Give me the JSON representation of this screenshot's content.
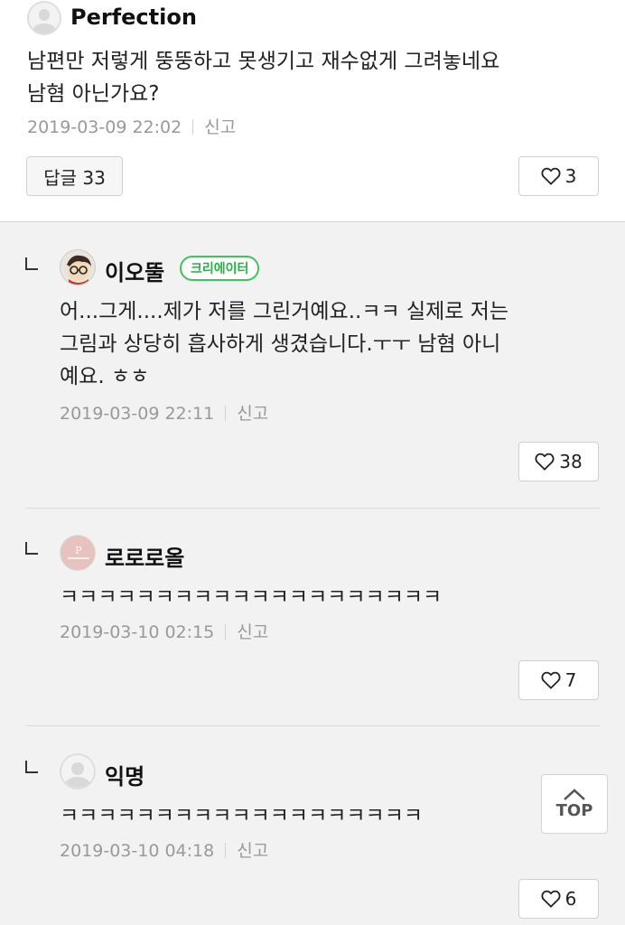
{
  "top_comment": {
    "author": "Perfection",
    "text_line1": "남편만 저렇게 뚱뚱하고 못생기고 재수없게 그려놓네요",
    "text_line2": "남혐 아닌가요?",
    "timestamp": "2019-03-09 22:02",
    "report_label": "신고",
    "reply_label": "답글 33",
    "like_count": "3"
  },
  "replies": [
    {
      "author": "이오뚤",
      "badge": "크리에이터",
      "text_line1": "어...그게....제가 저를 그린거예요..ㅋㅋ 실제로 저는",
      "text_line2": "그림과 상당히 흡사하게 생겼습니다.ㅜㅜ 남혐 아니",
      "text_line3": "예요. ㅎㅎ",
      "timestamp": "2019-03-09 22:11",
      "report_label": "신고",
      "like_count": "38"
    },
    {
      "author": "로로로올",
      "text_line1": "ㅋㅋㅋㅋㅋㅋㅋㅋㅋㅋㅋㅋㅋㅋㅋㅋㅋㅋㅋㅋ",
      "timestamp": "2019-03-10 02:15",
      "report_label": "신고",
      "like_count": "7"
    },
    {
      "author": "익명",
      "text_line1": "ㅋㅋㅋㅋㅋㅋㅋㅋㅋㅋㅋㅋㅋㅋㅋㅋㅋㅋㅋ",
      "timestamp": "2019-03-10 04:18",
      "report_label": "신고",
      "like_count": "6"
    }
  ],
  "top_button_label": "TOP",
  "icons": {
    "like": "heart-outline-icon",
    "reply_indent": "reply-corner-icon",
    "scroll_top": "chevron-up-icon"
  },
  "colors": {
    "creator_badge": "#3cc65a",
    "meta_text": "#999999"
  }
}
